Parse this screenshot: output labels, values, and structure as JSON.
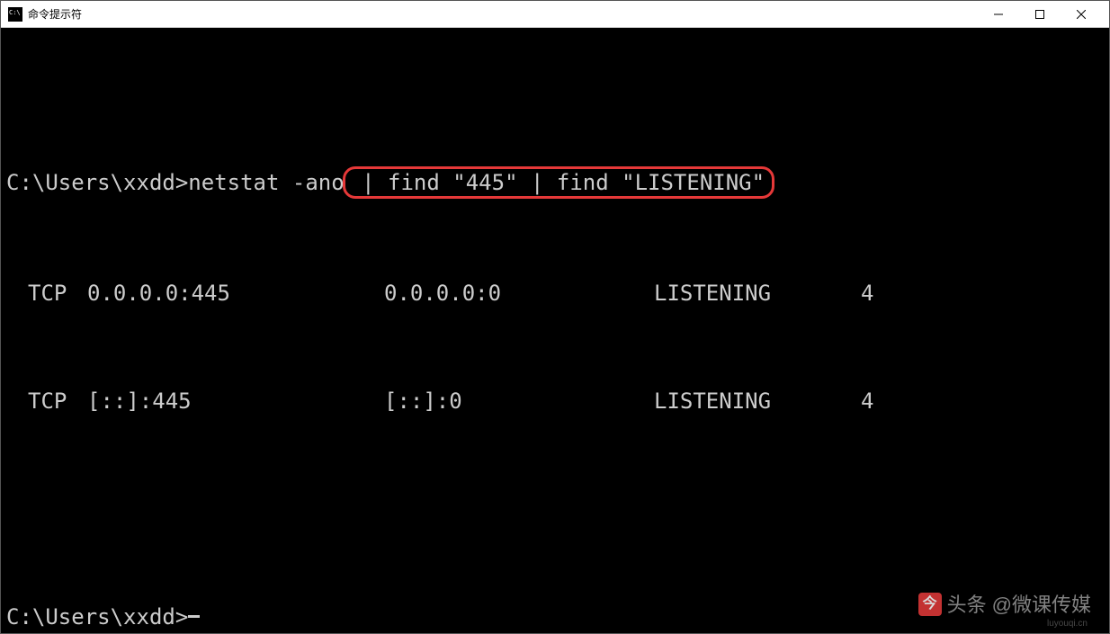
{
  "window": {
    "title": "命令提示符"
  },
  "terminal": {
    "prompt1": "C:\\Users\\xxdd>",
    "command_part1": "netstat -ano",
    "command_highlighted": " | find \"445\" | find \"LISTENING\"",
    "rows": [
      {
        "proto": "TCP",
        "local": "0.0.0.0:445",
        "foreign": "0.0.0.0:0",
        "state": "LISTENING",
        "pid": "4"
      },
      {
        "proto": "TCP",
        "local": "[::]:445",
        "foreign": "[::]:0",
        "state": "LISTENING",
        "pid": "4"
      }
    ],
    "prompt2": "C:\\Users\\xxdd>"
  },
  "watermark": {
    "label": "头条",
    "handle": "@微课传媒"
  }
}
